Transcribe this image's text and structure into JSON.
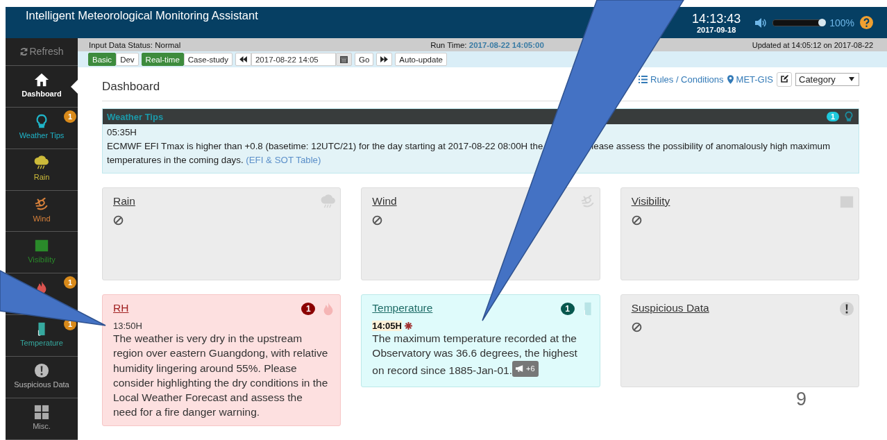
{
  "header": {
    "title": "Intelligent Meteorological Monitoring Assistant",
    "time": "14:13:43",
    "date": "2017-09-18",
    "volume": {
      "level": 1,
      "reading": "100%"
    }
  },
  "sidebar": {
    "refresh": "Refresh",
    "items": [
      {
        "kind": "home",
        "label": "Dashboard",
        "selected": true,
        "color": "#ffffff"
      },
      {
        "kind": "bulb",
        "label": "Weather Tips",
        "selected": false,
        "color": "#1fb5c9",
        "badge": "1"
      },
      {
        "kind": "rain",
        "label": "Rain",
        "selected": false,
        "color": "#cdbb3a"
      },
      {
        "kind": "wind",
        "label": "Wind",
        "selected": false,
        "color": "#d9823b"
      },
      {
        "kind": "visibility",
        "label": "Visibility",
        "selected": false,
        "color": "#2a8a2a"
      },
      {
        "kind": "fire",
        "selected": false,
        "color": "#d9534f",
        "badge": "1"
      },
      {
        "kind": "thermo",
        "label": "Temperature",
        "selected": false,
        "color": "#36a99f",
        "badge": "1"
      },
      {
        "kind": "alert",
        "label": "Suspicious Data",
        "selected": false,
        "color": "#bbbbbb"
      },
      {
        "kind": "grid",
        "label": "Misc.",
        "selected": false,
        "color": "#aaaaaa"
      }
    ]
  },
  "status": {
    "input": "Input Data Status: Normal",
    "run_label": "Run Time:",
    "run_time": "2017-08-22 14:05:00",
    "updated": "Updated at 14:05:12 on 2017-08-22"
  },
  "toolbar": {
    "modes": [
      {
        "label": "Basic",
        "selected": true
      },
      {
        "label": "Dev",
        "selected": false
      }
    ],
    "sources": [
      {
        "label": "Real-time",
        "selected": true
      },
      {
        "label": "Case-study",
        "selected": false
      }
    ],
    "date": "2017-08-22 14:05",
    "go": "Go",
    "auto_update": "Auto-update"
  },
  "page": {
    "title": "Dashboard",
    "rules": "Rules / Conditions",
    "gis": "MET-GIS",
    "category": "Category"
  },
  "tips": {
    "title": "Weather Tips",
    "count": "1",
    "time": "05:35H",
    "text_before": "ECMWF EFI Tmax is higher than +0.8 (basetime: 12UTC/21) for the day starting at 2017-08-22 08:00H the",
    "text_after": "lease assess the possibility of anomalously high maximum temperatures in the coming days.",
    "link": "(EFI & SOT Table)"
  },
  "cards": [
    {
      "kind": "neutral",
      "title": "Rain"
    },
    {
      "kind": "neutral",
      "title": "Wind"
    },
    {
      "kind": "neutral",
      "title": "Visibility"
    },
    {
      "kind": "alert",
      "title": "RH",
      "badge": "1",
      "time": "13:50H",
      "flagged": false,
      "text": "The weather is very dry in the upstream region over eastern Guangdong, with relative humidity lingering around 55%. Please consider highlighting the dry conditions in the Local Weather Forecast and assess the need for a fire danger warning."
    },
    {
      "kind": "info",
      "title": "Temperature",
      "badge": "1",
      "time": "14:05H",
      "flagged": true,
      "text": "The maximum temperature recorded at the Observatory was 36.6 degrees, the highest on record since 1885-Jan-01.",
      "extra": "+6"
    },
    {
      "kind": "neutral",
      "title": "Suspicious Data"
    }
  ],
  "slide_number": "9"
}
